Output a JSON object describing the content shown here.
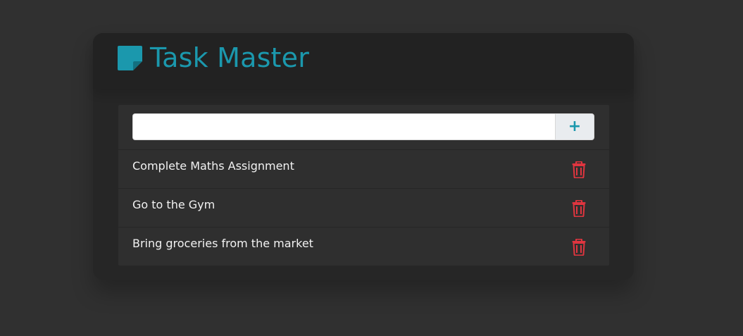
{
  "app": {
    "title": "Task Master",
    "logo_icon": "sticky-note-icon",
    "accent_color": "#1b98ad",
    "danger_color": "#e0353f"
  },
  "new_task": {
    "value": "",
    "placeholder": "",
    "add_label": "+",
    "add_icon": "plus-icon"
  },
  "tasks": [
    {
      "label": "Complete Maths Assignment",
      "delete_icon": "trash-icon"
    },
    {
      "label": "Go to the Gym",
      "delete_icon": "trash-icon"
    },
    {
      "label": "Bring groceries from the market",
      "delete_icon": "trash-icon"
    }
  ]
}
